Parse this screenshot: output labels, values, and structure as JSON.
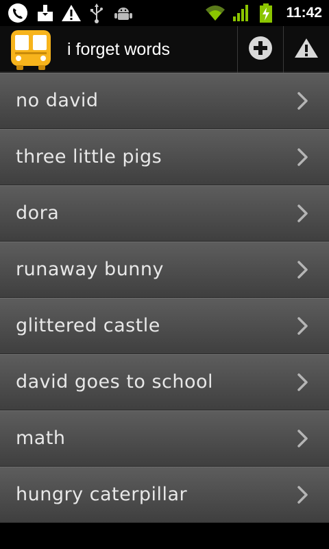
{
  "status_bar": {
    "time": "11:42",
    "icons": [
      "phone-call-icon",
      "download-icon",
      "warning-icon",
      "usb-icon",
      "android-debug-icon",
      "wifi-icon",
      "signal-icon",
      "battery-charging-icon"
    ]
  },
  "action_bar": {
    "title": "i forget words",
    "logo": "school-bus-icon",
    "add_button_icon": "add-icon",
    "warning_button_icon": "warning-icon"
  },
  "list": {
    "items": [
      {
        "label": "no david"
      },
      {
        "label": "three little pigs"
      },
      {
        "label": "dora"
      },
      {
        "label": "runaway bunny"
      },
      {
        "label": "glittered castle"
      },
      {
        "label": "david goes to school"
      },
      {
        "label": "math"
      },
      {
        "label": "hungry caterpillar"
      }
    ]
  },
  "colors": {
    "logo_yellow": "#f7b41c",
    "list_top": "#5d5d5d",
    "list_bottom": "#3f3f3f",
    "battery_green": "#8bc500"
  }
}
